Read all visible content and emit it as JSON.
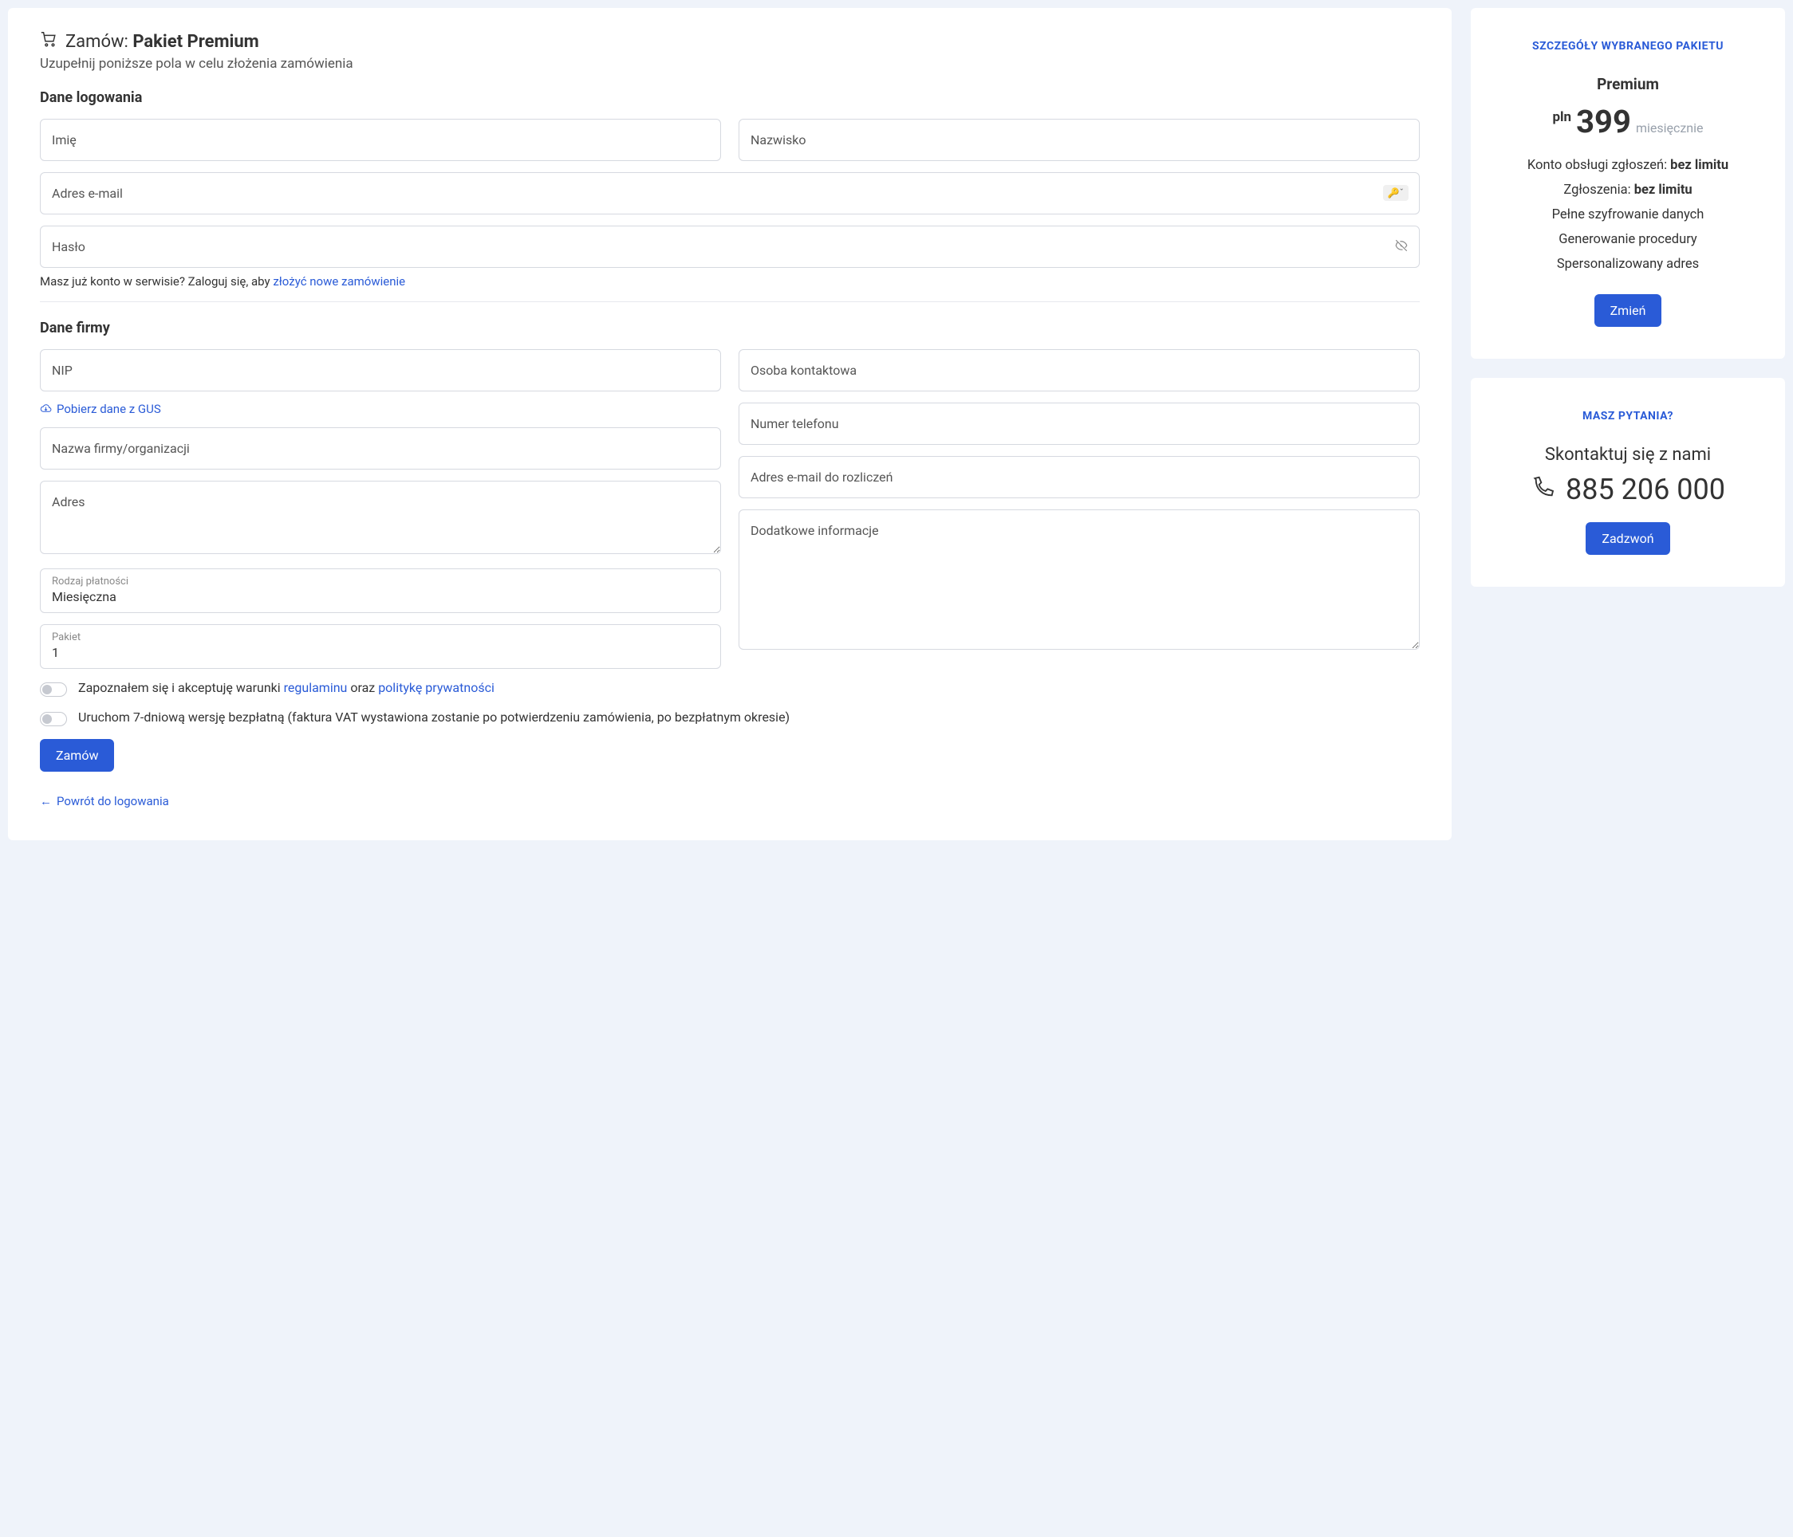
{
  "header": {
    "title_prefix": "Zamów:",
    "title_bold": "Pakiet Premium",
    "subtitle": "Uzupełnij poniższe pola w celu złożenia zamówienia"
  },
  "login_section": {
    "heading": "Dane logowania",
    "first_name_placeholder": "Imię",
    "last_name_placeholder": "Nazwisko",
    "email_placeholder": "Adres e-mail",
    "password_placeholder": "Hasło",
    "have_account_text": "Masz już konto w serwisie? Zaloguj się, aby ",
    "have_account_link": "złożyć nowe zamówienie"
  },
  "company_section": {
    "heading": "Dane firmy",
    "nip_placeholder": "NIP",
    "gus_link": "Pobierz dane z GUS",
    "company_name_placeholder": "Nazwa firmy/organizacji",
    "address_placeholder": "Adres",
    "contact_person_placeholder": "Osoba kontaktowa",
    "phone_placeholder": "Numer telefonu",
    "billing_email_placeholder": "Adres e-mail do rozliczeń",
    "extra_info_placeholder": "Dodatkowe informacje",
    "payment_type_label": "Rodzaj płatności",
    "payment_type_value": "Miesięczna",
    "package_label": "Pakiet",
    "package_value": "1"
  },
  "toggles": {
    "terms_prefix": "Zapoznałem się i akceptuję warunki ",
    "terms_link1": "regulaminu",
    "terms_mid": " oraz ",
    "terms_link2": "politykę prywatności",
    "trial_text": "Uruchom 7-dniową wersję bezpłatną (faktura VAT wystawiona zostanie po potwierdzeniu zamówienia, po bezpłatnym okresie)"
  },
  "actions": {
    "submit": "Zamów",
    "back": "Powrót do logowania"
  },
  "plan_card": {
    "heading": "SZCZEGÓŁY WYBRANEGO PAKIETU",
    "name": "Premium",
    "currency": "pln",
    "amount": "399",
    "period": "miesięcznie",
    "feature1_prefix": "Konto obsługi zgłoszeń: ",
    "feature1_bold": "bez limitu",
    "feature2_prefix": "Zgłoszenia: ",
    "feature2_bold": "bez limitu",
    "feature3": "Pełne szyfrowanie danych",
    "feature4": "Generowanie procedury",
    "feature5": "Spersonalizowany adres",
    "change_btn": "Zmień"
  },
  "contact_card": {
    "heading": "MASZ PYTANIA?",
    "subheading": "Skontaktuj się z nami",
    "phone": "885 206 000",
    "call_btn": "Zadzwoń"
  }
}
